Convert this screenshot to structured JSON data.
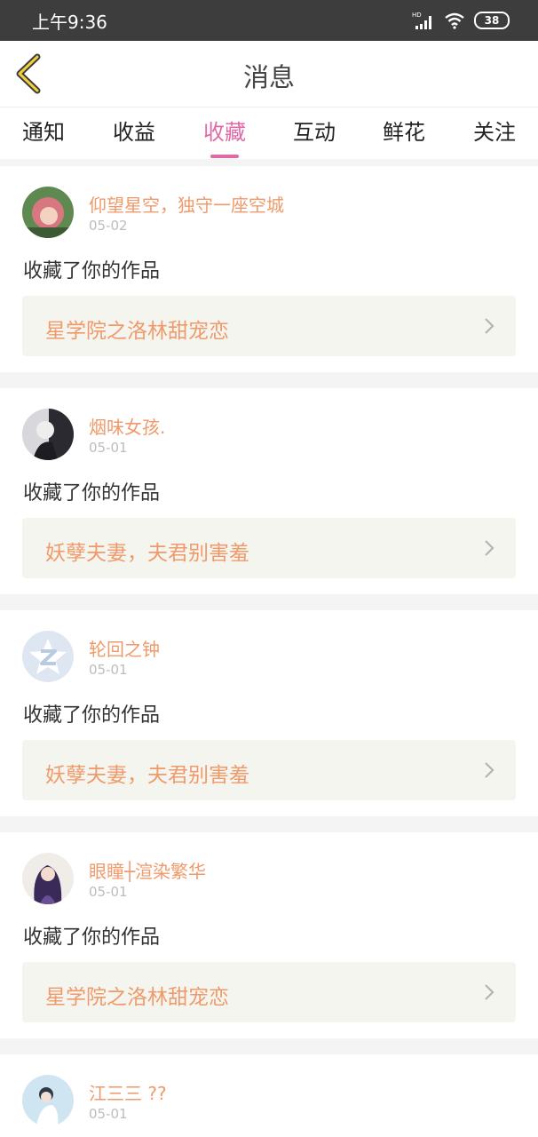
{
  "status_bar": {
    "time": "上午9:36",
    "battery": "38",
    "network": "HD"
  },
  "header": {
    "title": "消息"
  },
  "tabs": [
    "通知",
    "收益",
    "收藏",
    "互动",
    "鲜花",
    "关注"
  ],
  "active_tab": "收藏",
  "messages": [
    {
      "user": "仰望星空，独守一座空城",
      "date": "05-02",
      "action": "收藏了你的作品",
      "work": "星学院之洛林甜宠恋"
    },
    {
      "user": "烟味女孩.",
      "date": "05-01",
      "action": "收藏了你的作品",
      "work": "妖孽夫妻，夫君别害羞"
    },
    {
      "user": "轮回之钟",
      "date": "05-01",
      "action": "收藏了你的作品",
      "work": "妖孽夫妻，夫君别害羞"
    },
    {
      "user": "眼瞳┼渲染繁华",
      "date": "05-01",
      "action": "收藏了你的作品",
      "work": "星学院之洛林甜宠恋"
    },
    {
      "user": "江三三 ??",
      "date": "05-01"
    }
  ],
  "colors": {
    "accent": "#e06aa7",
    "username": "#ef9a6b",
    "work_bg": "#f5f5f0"
  }
}
